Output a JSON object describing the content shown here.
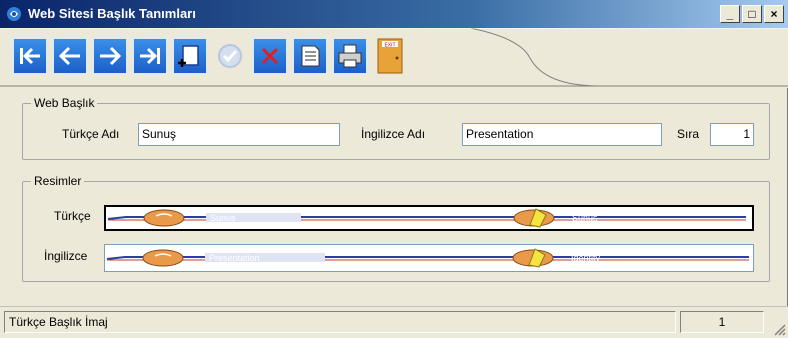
{
  "window": {
    "title": "Web Sitesi Başlık Tanımları"
  },
  "window_controls": {
    "minimize": "_",
    "maximize": "□",
    "close": "×"
  },
  "toolbar": {
    "buttons": [
      {
        "name": "first",
        "icon": "first-record-icon"
      },
      {
        "name": "previous",
        "icon": "arrow-left-icon"
      },
      {
        "name": "next",
        "icon": "arrow-right-icon"
      },
      {
        "name": "last",
        "icon": "last-record-icon"
      },
      {
        "name": "new",
        "icon": "new-document-icon"
      },
      {
        "name": "save",
        "icon": "check-icon"
      },
      {
        "name": "delete",
        "icon": "delete-icon"
      },
      {
        "name": "report",
        "icon": "report-icon"
      },
      {
        "name": "print",
        "icon": "printer-icon"
      },
      {
        "name": "exit",
        "icon": "exit-door-icon",
        "text": "EXIT"
      }
    ]
  },
  "web_baslik": {
    "legend": "Web Başlık",
    "turkce_label": "Türkçe Adı",
    "turkce_value": "Sunuş",
    "ingilizce_label": "İngilizce Adı",
    "ingilizce_value": "Presentation",
    "sira_label": "Sıra",
    "sira_value": "1"
  },
  "resimler": {
    "legend": "Resimler",
    "turkce_label": "Türkçe",
    "ingilizce_label": "İngilizce",
    "turkce_banner": {
      "left_text": "Sunuş",
      "right_text": "Sunuş"
    },
    "ingilizce_banner": {
      "left_text": "Presentation",
      "right_text": "Identity"
    }
  },
  "statusbar": {
    "text": "Türkçe Başlık İmaj",
    "record": "1"
  },
  "colors": {
    "title_start": "#0a246a",
    "toolbar_blue": "#1c5fc8",
    "banner_line": "#2a3fa0",
    "banner_red": "#c0392b"
  }
}
